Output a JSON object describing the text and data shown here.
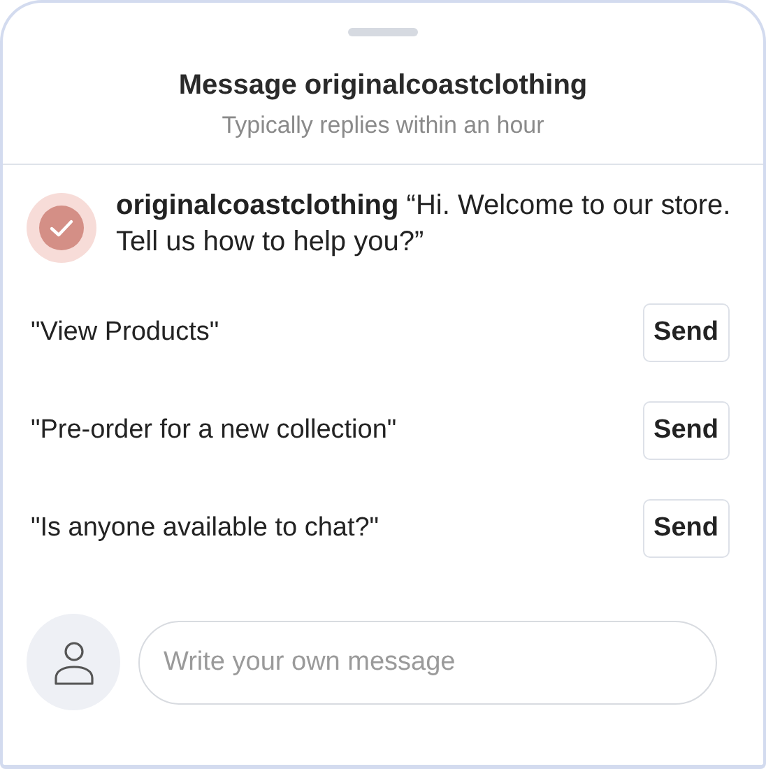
{
  "header": {
    "title": "Message originalcoastclothing",
    "subtitle": "Typically replies within an hour"
  },
  "greeting": {
    "text": "**originalcoastclothing** “Hi. Welcome to our store. Tell us how to help you?”"
  },
  "quick_replies": [
    {
      "text": "\"View Products\"",
      "button": "Send"
    },
    {
      "text": "\"Pre-order for a new collection\"",
      "button": "Send"
    },
    {
      "text": "\"Is anyone available to chat?\"",
      "button": "Send"
    }
  ],
  "composer": {
    "placeholder": "Write your own message"
  }
}
